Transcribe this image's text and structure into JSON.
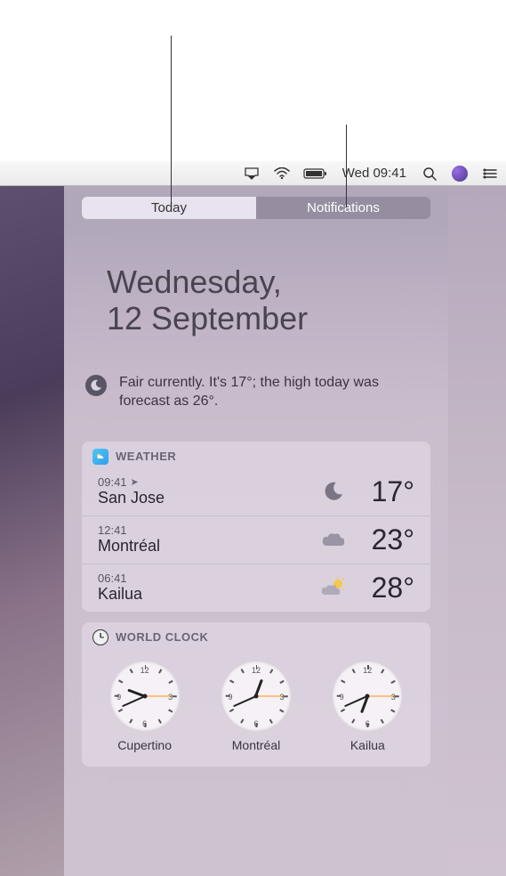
{
  "menubar": {
    "datetime": "Wed 09:41"
  },
  "tabs": {
    "today": "Today",
    "notifications": "Notifications"
  },
  "today_view": {
    "date_line1": "Wednesday,",
    "date_line2": "12 September",
    "summary": "Fair currently. It's 17°; the high today was forecast as 26°."
  },
  "weather": {
    "title": "WEATHER",
    "locations": [
      {
        "time": "09:41",
        "current_location": true,
        "city": "San Jose",
        "condition": "clear-night",
        "temp": "17°"
      },
      {
        "time": "12:41",
        "current_location": false,
        "city": "Montréal",
        "condition": "cloudy",
        "temp": "23°"
      },
      {
        "time": "06:41",
        "current_location": false,
        "city": "Kailua",
        "condition": "partly-sunny",
        "temp": "28°"
      }
    ]
  },
  "world_clock": {
    "title": "WORLD CLOCK",
    "clocks": [
      {
        "city": "Cupertino",
        "hour": 9,
        "minute": 41,
        "second": 15
      },
      {
        "city": "Montréal",
        "hour": 12,
        "minute": 41,
        "second": 15
      },
      {
        "city": "Kailua",
        "hour": 6,
        "minute": 41,
        "second": 15
      }
    ]
  }
}
